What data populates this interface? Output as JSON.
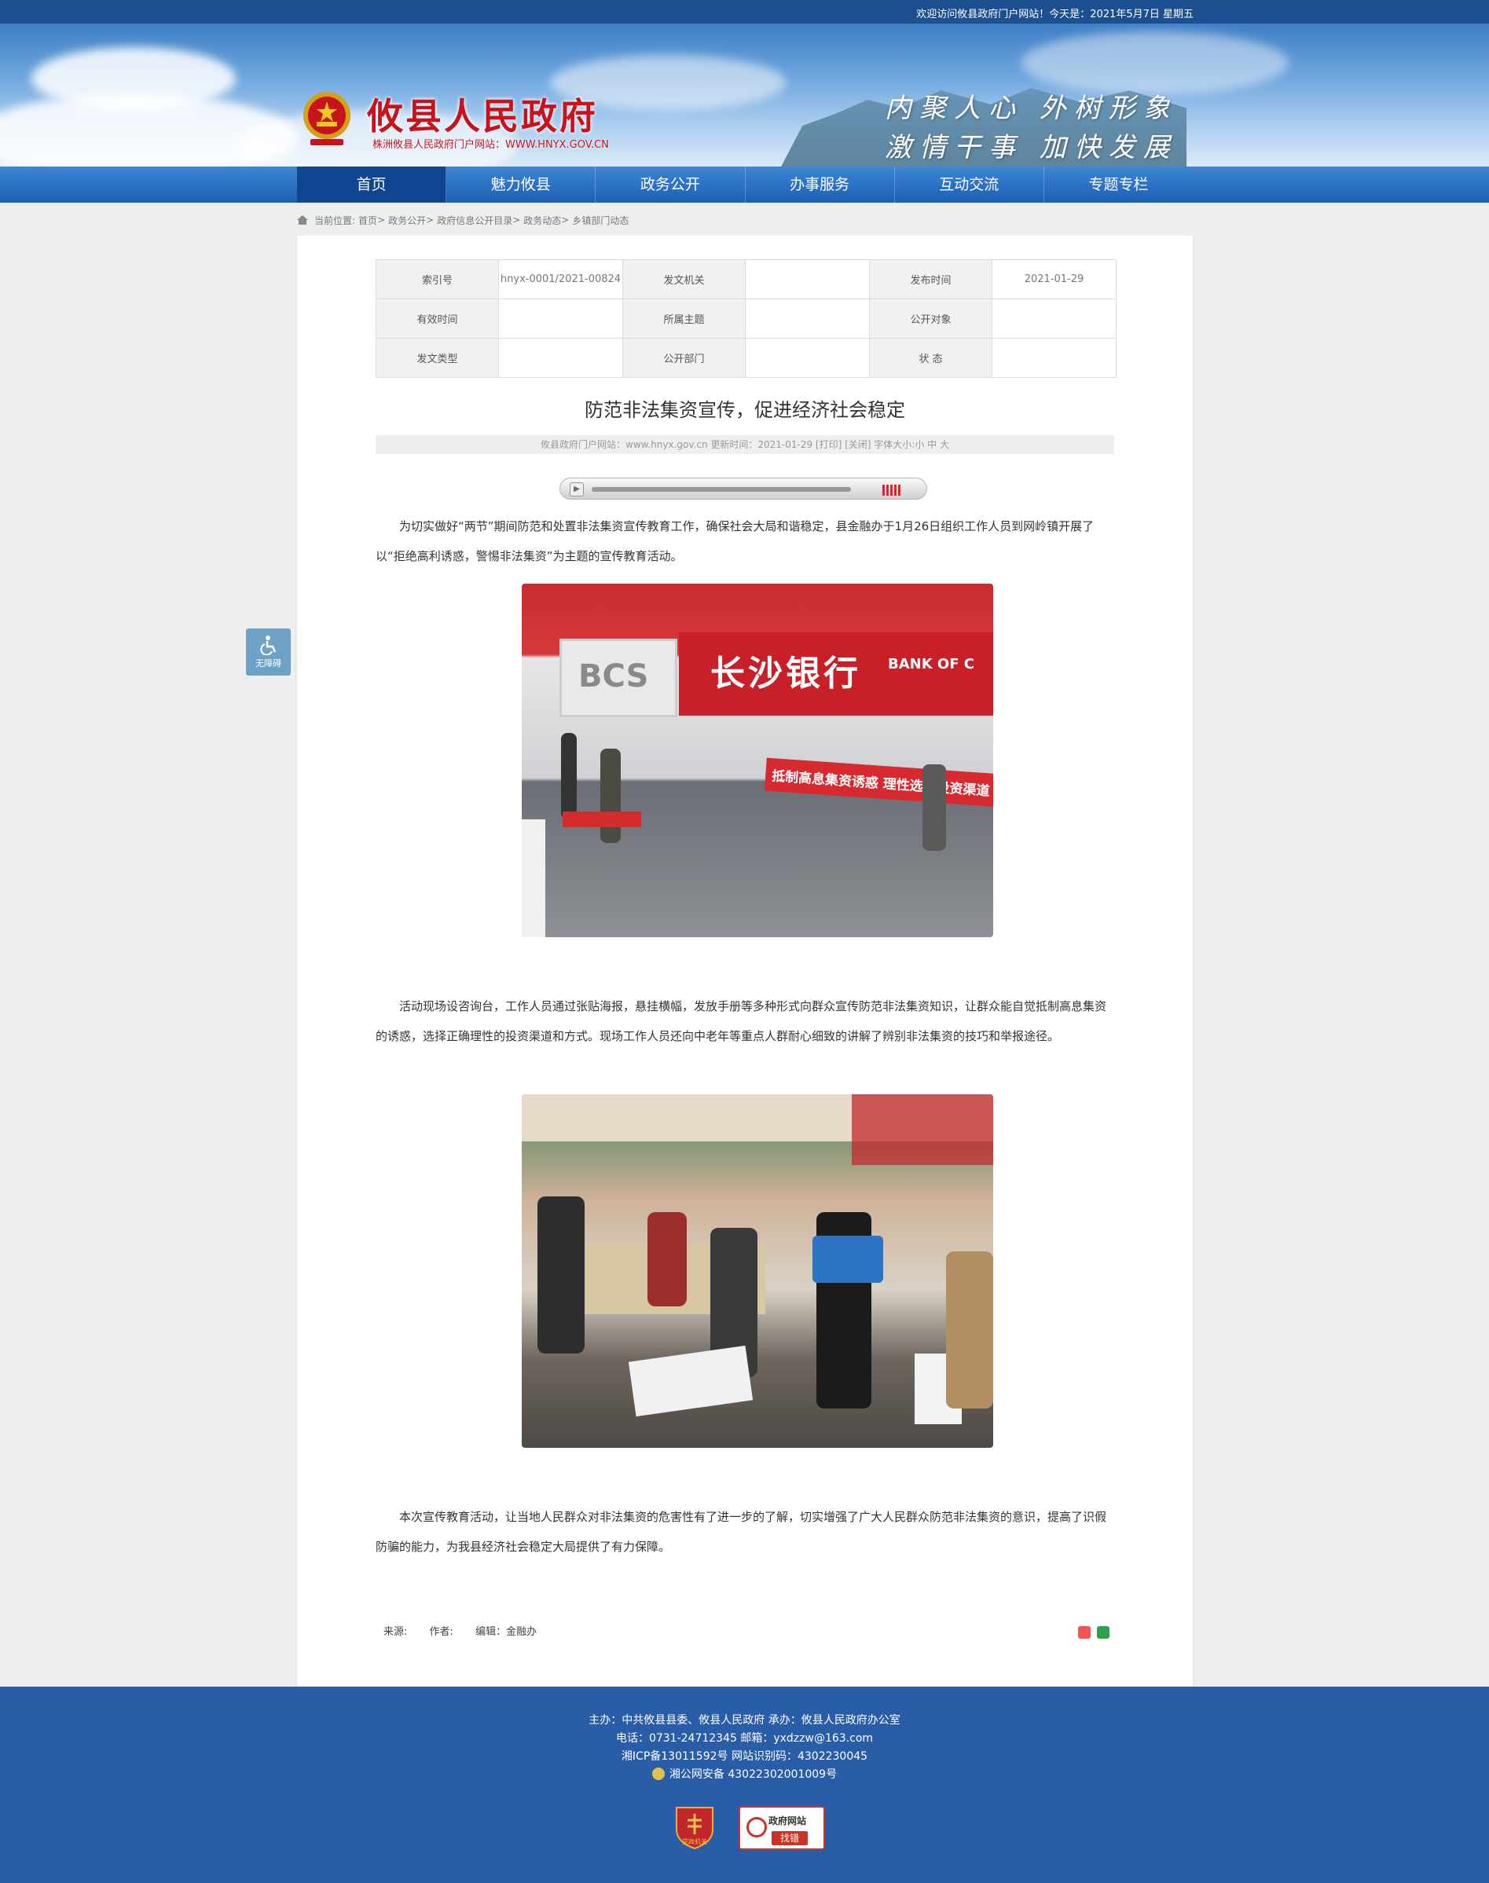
{
  "topbar": {
    "welcome": "欢迎访问攸县政府门户网站！今天是：2021年5月7日 星期五"
  },
  "header": {
    "site_name": "攸县人民政府",
    "site_sub": "株洲攸县人民政府门户网站：WWW.HNYX.GOV.CN",
    "slogan_1": "内聚人心  外树形象",
    "slogan_2": "激情干事  加快发展"
  },
  "nav": {
    "items": [
      "首页",
      "魅力攸县",
      "政务公开",
      "办事服务",
      "互动交流",
      "专题专栏"
    ],
    "active": 0
  },
  "breadcrumb": {
    "label": "当前位置:",
    "items": [
      "首页",
      "政务公开",
      "政府信息公开目录",
      "政务动态",
      "乡镇部门动态"
    ],
    "separator": ">"
  },
  "meta_table": [
    [
      {
        "k": "索引号",
        "v": "hnyx-0001/2021-00824"
      },
      {
        "k": "发文机关",
        "v": ""
      },
      {
        "k": "发布时间",
        "v": "2021-01-29"
      }
    ],
    [
      {
        "k": "有效时间",
        "v": ""
      },
      {
        "k": "所属主题",
        "v": ""
      },
      {
        "k": "公开对象",
        "v": ""
      }
    ],
    [
      {
        "k": "发文类型",
        "v": ""
      },
      {
        "k": "公开部门",
        "v": ""
      },
      {
        "k": "状  态",
        "v": ""
      }
    ]
  ],
  "article": {
    "title": "防范非法集资宣传，促进经济社会稳定",
    "info": "攸县政府门户网站：www.hnyx.gov.cn   更新时间：2021-01-29   [打印]  [关闭]   字体大小:小 中 大",
    "paragraphs": [
      "为切实做好“两节”期间防范和处置非法集资宣传教育工作，确保社会大局和谐稳定，县金融办于1月26日组织工作人员到网岭镇开展了以“拒绝高利诱惑，警惕非法集资”为主题的宣传教育活动。",
      "活动现场设咨询台，工作人员通过张贴海报，悬挂横幅，发放手册等多种形式向群众宣传防范非法集资知识，让群众能自觉抵制高息集资的诱惑，选择正确理性的投资渠道和方式。现场工作人员还向中老年等重点人群耐心细致的讲解了辨别非法集资的技巧和举报途径。",
      "本次宣传教育活动，让当地人民群众对非法集资的危害性有了进一步的了解，切实增强了广大人民群众防范非法集资的意识，提高了识假防骗的能力，为我县经济社会稳定大局提供了有力保障。"
    ],
    "photo1": {
      "sign_left": "BCS",
      "sign_right": "长沙银行",
      "sign_en": "BANK OF C",
      "banner": "抵制高息集资诱惑   理性选择投资渠道"
    },
    "source": "来源:",
    "author": "作者:",
    "editor": "编辑：金融办"
  },
  "access": {
    "label": "无障碍"
  },
  "footer": {
    "line1": "主办：中共攸县县委、攸县人民政府  承办：攸县人民政府办公室",
    "line2": "电话：0731-24712345  邮箱：yxdzzw@163.com",
    "line3": "湘ICP备13011592号   网站识别码：4302230045",
    "line4": "湘公网安备 43022302001009号",
    "badge1": "党政机关",
    "badge2_title": "政府网站",
    "badge2_btn": "找错"
  },
  "colors": {
    "brand_red": "#c8121c",
    "nav_blue": "#1b5fb3",
    "footer_blue": "#2a5da8"
  }
}
